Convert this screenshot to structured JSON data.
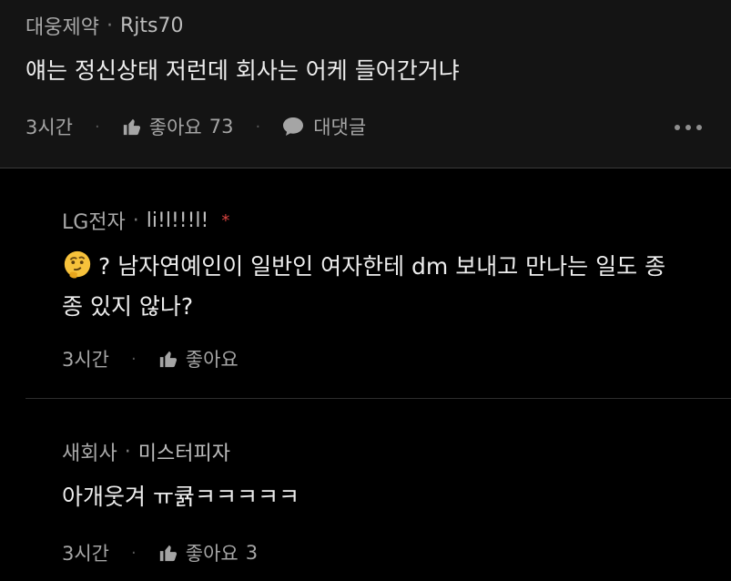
{
  "comments": [
    {
      "company": "대웅제약",
      "nickname": "Rjts70",
      "text": "얘는 정신상태 저런데 회사는 어케 들어간거냐",
      "time": "3시간",
      "like_label": "좋아요",
      "like_count": "73",
      "reply_label": "대댓글"
    },
    {
      "company": "LG전자",
      "nickname": "li!l!!!l!",
      "star": "*",
      "emoji": "thinking-face-icon",
      "line1": "? 남자연예인이 일반인 여자한테 dm 보내고 만나는 일도 종",
      "line2": "종 있지 않나?",
      "time": "3시간",
      "like_label": "좋아요"
    },
    {
      "company": "새회사",
      "nickname": "미스터피자",
      "text": "아개웃겨 ㅠ큙ㅋㅋㅋㅋㅋ",
      "time": "3시간",
      "like_label": "좋아요",
      "like_count": "3"
    }
  ],
  "colors": {
    "top_background": "#141414",
    "reply_background": "#000000",
    "accent_star": "#d9433f"
  }
}
